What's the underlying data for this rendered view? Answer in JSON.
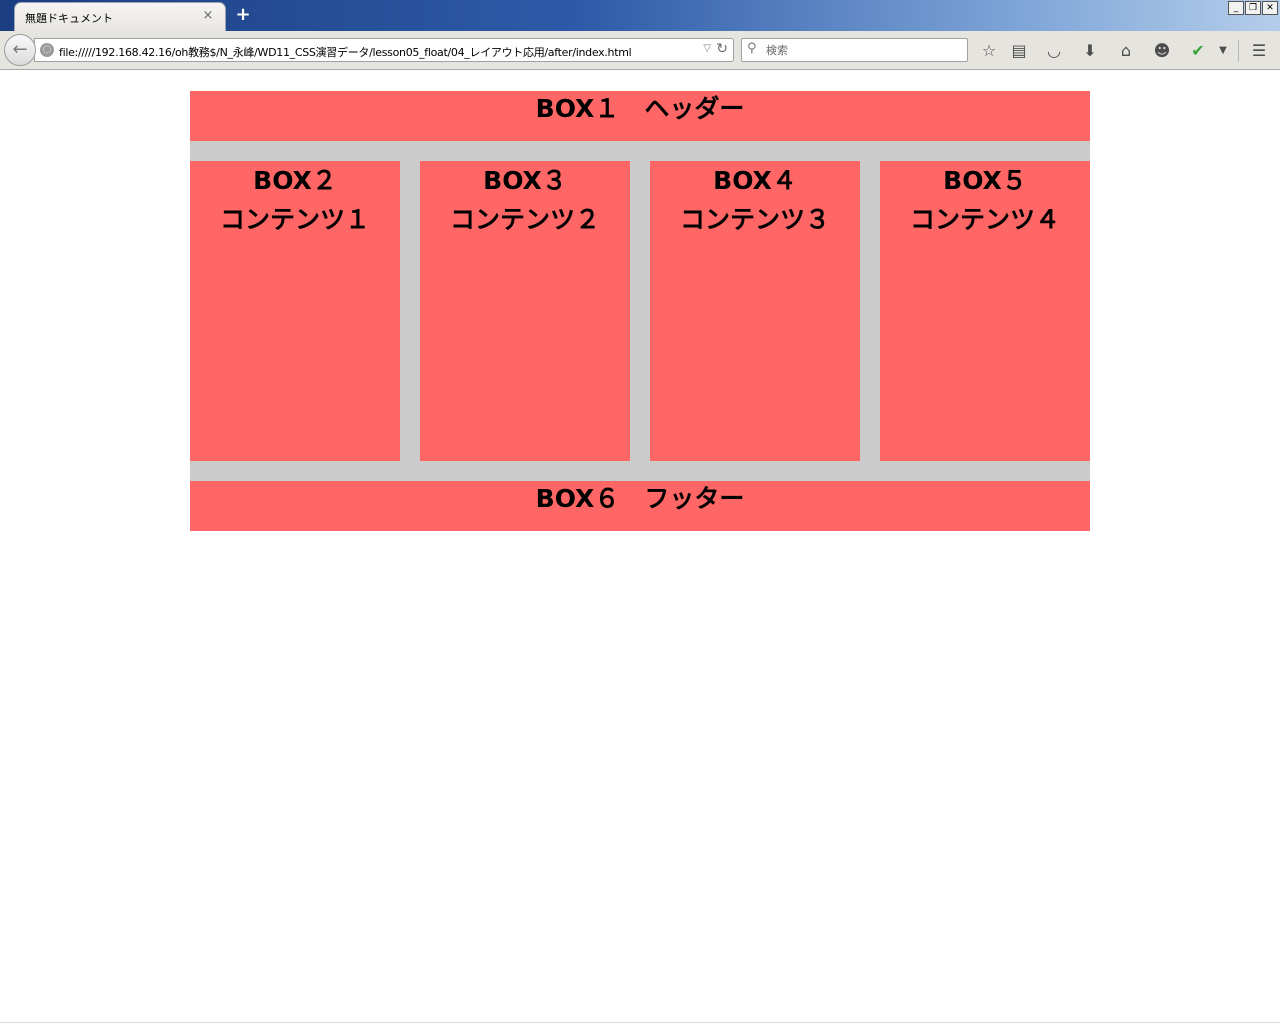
{
  "window": {
    "tab_title": "無題ドキュメント",
    "tab_close": "×",
    "new_tab": "+",
    "controls": {
      "minimize": "_",
      "restore": "❐",
      "close": "✕"
    }
  },
  "toolbar": {
    "url": "file://///192.168.42.16/oh教務$/N_永峰/WD11_CSS演習データ/lesson05_float/04_レイアウト応用/after/index.html",
    "search_placeholder": "検索",
    "icons": [
      "bookmark-star-icon",
      "reading-list-icon",
      "pocket-icon",
      "download-icon",
      "home-icon",
      "chat-icon",
      "addon-check-icon",
      "dropdown-icon",
      "menu-icon"
    ]
  },
  "page": {
    "header": "BOX１　ヘッダー",
    "boxes": [
      {
        "box": "BOX２",
        "content": "コンテンツ１"
      },
      {
        "box": "BOX３",
        "content": "コンテンツ２"
      },
      {
        "box": "BOX４",
        "content": "コンテンツ３"
      },
      {
        "box": "BOX５",
        "content": "コンテンツ４"
      }
    ],
    "footer": "BOX６　フッター"
  },
  "colors": {
    "box": "#ff6666",
    "wrapper": "#cccccc",
    "page_background": "#ffffff"
  }
}
